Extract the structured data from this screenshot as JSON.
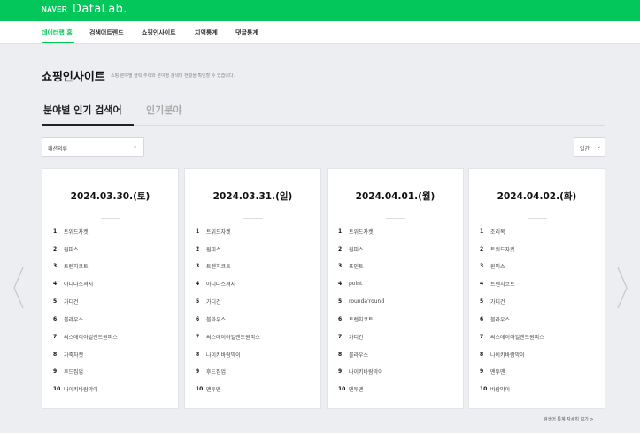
{
  "brand": {
    "naver": "NAVER",
    "datalab": "DataLab."
  },
  "nav": {
    "items": [
      {
        "label": "데이터랩 홈",
        "active": true
      },
      {
        "label": "검색어트렌드",
        "active": false
      },
      {
        "label": "쇼핑인사이트",
        "active": false
      },
      {
        "label": "지역통계",
        "active": false
      },
      {
        "label": "댓글통계",
        "active": false
      }
    ]
  },
  "page": {
    "title": "쇼핑인사이트",
    "description": "쇼핑 분야별 클릭 추이와 분야별 검색어 현황을 확인할 수 있습니다."
  },
  "tabs": [
    {
      "label": "분야별 인기 검색어",
      "active": true
    },
    {
      "label": "인기분야",
      "active": false
    }
  ],
  "filters": {
    "category": "패션의류",
    "period": "일간"
  },
  "cards": [
    {
      "date": "2024.03.30.(토)",
      "ranks": [
        {
          "rank": "1",
          "keyword": "트위드자켓"
        },
        {
          "rank": "2",
          "keyword": "원피스"
        },
        {
          "rank": "3",
          "keyword": "트렌치코트"
        },
        {
          "rank": "4",
          "keyword": "아디다스져지"
        },
        {
          "rank": "5",
          "keyword": "가디건"
        },
        {
          "rank": "6",
          "keyword": "블라우스"
        },
        {
          "rank": "7",
          "keyword": "써스데이아일랜드원피스"
        },
        {
          "rank": "8",
          "keyword": "가죽자켓"
        },
        {
          "rank": "9",
          "keyword": "후드집업"
        },
        {
          "rank": "10",
          "keyword": "나이키바람막이"
        }
      ]
    },
    {
      "date": "2024.03.31.(일)",
      "ranks": [
        {
          "rank": "1",
          "keyword": "트위드자켓"
        },
        {
          "rank": "2",
          "keyword": "원피스"
        },
        {
          "rank": "3",
          "keyword": "트렌치코트"
        },
        {
          "rank": "4",
          "keyword": "아디다스져지"
        },
        {
          "rank": "5",
          "keyword": "가디건"
        },
        {
          "rank": "6",
          "keyword": "블라우스"
        },
        {
          "rank": "7",
          "keyword": "써스데이아일랜드원피스"
        },
        {
          "rank": "8",
          "keyword": "나이키바람막이"
        },
        {
          "rank": "9",
          "keyword": "후드집업"
        },
        {
          "rank": "10",
          "keyword": "맨투맨"
        }
      ]
    },
    {
      "date": "2024.04.01.(월)",
      "ranks": [
        {
          "rank": "1",
          "keyword": "트위드자켓"
        },
        {
          "rank": "2",
          "keyword": "원피스"
        },
        {
          "rank": "3",
          "keyword": "포인트"
        },
        {
          "rank": "4",
          "keyword": "point"
        },
        {
          "rank": "5",
          "keyword": "rounda'round"
        },
        {
          "rank": "6",
          "keyword": "트렌치코트"
        },
        {
          "rank": "7",
          "keyword": "가디건"
        },
        {
          "rank": "8",
          "keyword": "블라우스"
        },
        {
          "rank": "9",
          "keyword": "나이키바람막이"
        },
        {
          "rank": "10",
          "keyword": "맨투맨"
        }
      ]
    },
    {
      "date": "2024.04.02.(화)",
      "ranks": [
        {
          "rank": "1",
          "keyword": "조리복"
        },
        {
          "rank": "2",
          "keyword": "트위드자켓"
        },
        {
          "rank": "3",
          "keyword": "원피스"
        },
        {
          "rank": "4",
          "keyword": "트렌치코트"
        },
        {
          "rank": "5",
          "keyword": "가디건"
        },
        {
          "rank": "6",
          "keyword": "블라우스"
        },
        {
          "rank": "7",
          "keyword": "써스데이아일랜드원피스"
        },
        {
          "rank": "8",
          "keyword": "나이키바람막이"
        },
        {
          "rank": "9",
          "keyword": "맨투맨"
        },
        {
          "rank": "10",
          "keyword": "바람막이"
        }
      ]
    }
  ],
  "more_link": "검색어 통계 자세히 보기 >",
  "colors": {
    "brand_green": "#03c75a",
    "background": "#eceef2"
  }
}
